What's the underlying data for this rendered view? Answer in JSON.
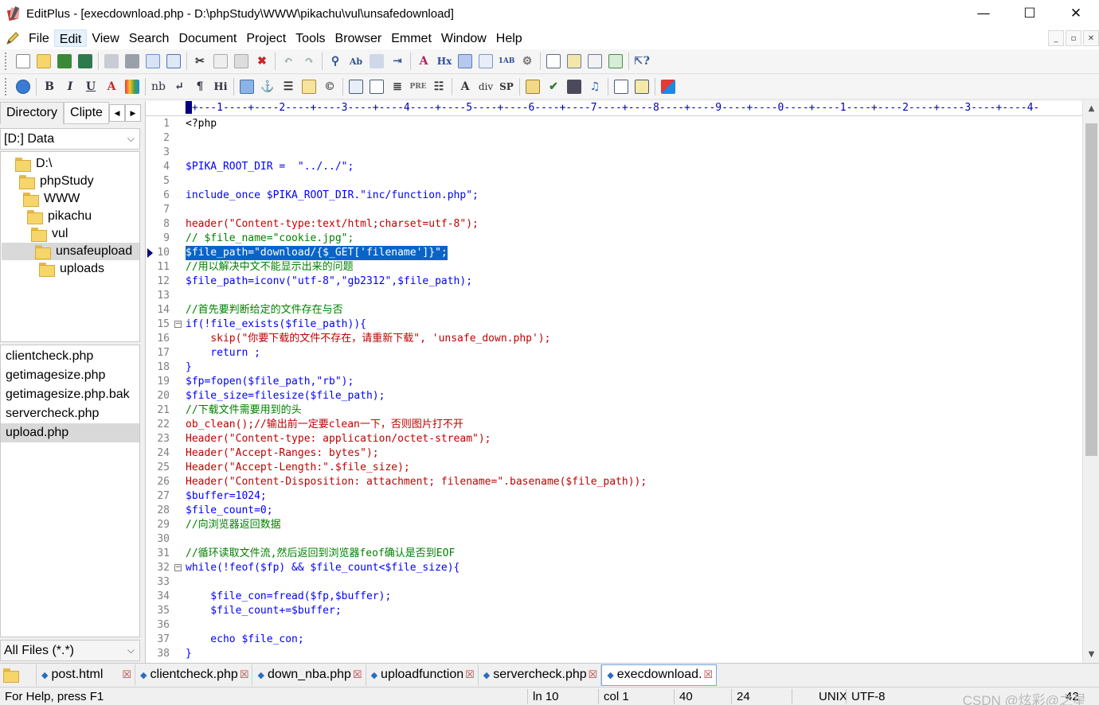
{
  "window": {
    "title": "EditPlus - [execdownload.php - D:\\phpStudy\\WWW\\pikachu\\vul\\unsafedownload]",
    "minimize": "—",
    "maximize": "☐",
    "close": "✕"
  },
  "menu": [
    "File",
    "Edit",
    "View",
    "Search",
    "Document",
    "Project",
    "Tools",
    "Browser",
    "Emmet",
    "Window",
    "Help"
  ],
  "toolbar2_text": {
    "bold": "B",
    "italic": "I",
    "underline": "U",
    "font_color": "A",
    "nb": "nb",
    "br": "↵",
    "pilcrow": "¶",
    "heading": "Hi",
    "pre": "PRE",
    "div": "div",
    "sp": "SP",
    "hx": "Hx"
  },
  "sidebar": {
    "tabs": [
      "Directory",
      "Clipte"
    ],
    "drive": "[D:] Data",
    "tree": [
      "D:\\",
      "phpStudy",
      "WWW",
      "pikachu",
      "vul",
      "unsafeupload",
      "uploads"
    ],
    "files": [
      "clientcheck.php",
      "getimagesize.php",
      "getimagesize.php.bak",
      "servercheck.php",
      "upload.php"
    ],
    "filter": "All Files (*.*)"
  },
  "ruler": "+---1----+----2----+----3----+----4----+----5----+----6----+----7----+----8----+----9----+----0----+----1----+----2----+----3----+----4-",
  "code": [
    "<?php",
    "",
    "",
    "$PIKA_ROOT_DIR =  \"../../\";",
    "",
    "include_once $PIKA_ROOT_DIR.\"inc/function.php\";",
    "",
    "header(\"Content-type:text/html;charset=utf-8\");",
    "// $file_name=\"cookie.jpg\";",
    "$file_path=\"download/{$_GET['filename']}\";",
    "//用以解决中文不能显示出来的问题",
    "$file_path=iconv(\"utf-8\",\"gb2312\",$file_path);",
    "",
    "//首先要判断给定的文件存在与否",
    "if(!file_exists($file_path)){",
    "    skip(\"你要下载的文件不存在，请重新下载\", 'unsafe_down.php');",
    "    return ;",
    "}",
    "$fp=fopen($file_path,\"rb\");",
    "$file_size=filesize($file_path);",
    "//下载文件需要用到的头",
    "ob_clean();//输出前一定要clean一下，否则图片打不开",
    "Header(\"Content-type: application/octet-stream\");",
    "Header(\"Accept-Ranges: bytes\");",
    "Header(\"Accept-Length:\".$file_size);",
    "Header(\"Content-Disposition: attachment; filename=\".basename($file_path));",
    "$buffer=1024;",
    "$file_count=0;",
    "//向浏览器返回数据",
    "",
    "//循环读取文件流,然后返回到浏览器feof确认是否到EOF",
    "while(!feof($fp) && $file_count<$file_size){",
    "",
    "    $file_con=fread($fp,$buffer);",
    "    $file_count+=$buffer;",
    "",
    "    echo $file_con;",
    "}"
  ],
  "line_numbers": [
    "1",
    "2",
    "3",
    "4",
    "5",
    "6",
    "7",
    "8",
    "9",
    "10",
    "11",
    "12",
    "13",
    "14",
    "15",
    "16",
    "17",
    "18",
    "19",
    "20",
    "21",
    "22",
    "23",
    "24",
    "25",
    "26",
    "27",
    "28",
    "29",
    "30",
    "31",
    "32",
    "33",
    "34",
    "35",
    "36",
    "37",
    "38"
  ],
  "doc_tabs": [
    "post.html",
    "clientcheck.php",
    "down_nba.php",
    "uploadfunction",
    "servercheck.php",
    "execdownload."
  ],
  "status": {
    "help": "For Help, press F1",
    "line": "ln 10",
    "col": "col 1",
    "a": "40",
    "b": "24",
    "eol": "UNIX",
    "enc": "UTF-8",
    "num": "42"
  },
  "watermark": "CSDN @炫彩@之星"
}
